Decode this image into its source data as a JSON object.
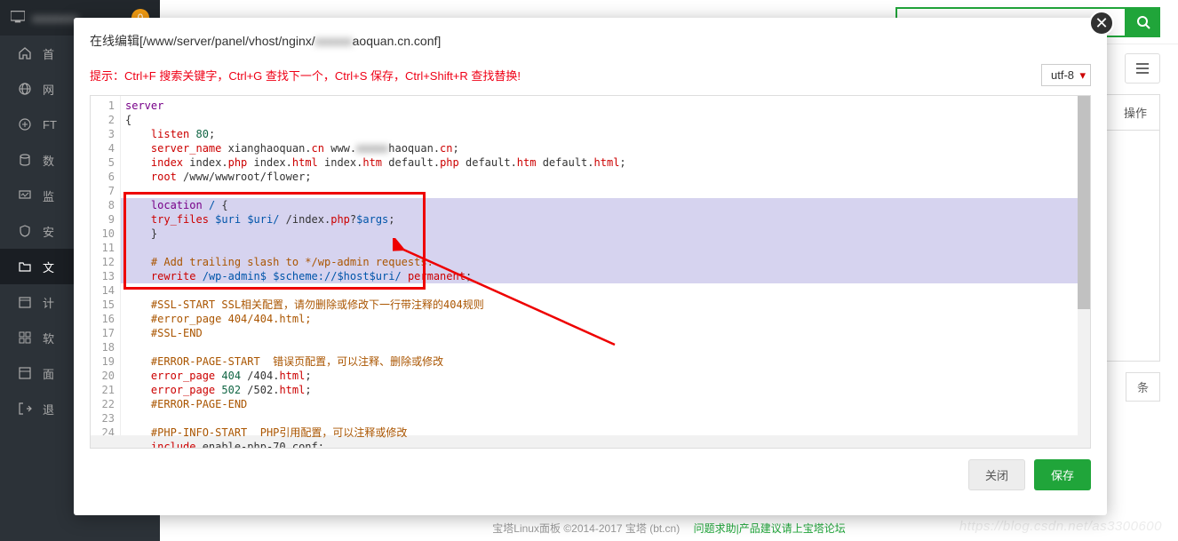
{
  "sidebar": {
    "badge": "0",
    "items": [
      {
        "label": "首",
        "icon": "home"
      },
      {
        "label": "网",
        "icon": "globe"
      },
      {
        "label": "FT",
        "icon": "ftp"
      },
      {
        "label": "数",
        "icon": "db"
      },
      {
        "label": "监",
        "icon": "monitor"
      },
      {
        "label": "安",
        "icon": "shield"
      },
      {
        "label": "文",
        "icon": "folder",
        "active": true
      },
      {
        "label": "计",
        "icon": "calendar"
      },
      {
        "label": "软",
        "icon": "soft"
      },
      {
        "label": "面",
        "icon": "panel"
      },
      {
        "label": "退",
        "icon": "logout"
      }
    ]
  },
  "topbar": {
    "search_placeholder": ""
  },
  "table": {
    "head_action": "操作",
    "foot_unit": "条"
  },
  "footer": {
    "copyright": "宝塔Linux面板 ©2014-2017 宝塔 (bt.cn)",
    "link": "问题求助|产品建议请上宝塔论坛"
  },
  "modal": {
    "title_prefix": "在线编辑[/www/server/panel/vhost/nginx/",
    "title_blur": "xxxxxx",
    "title_suffix": "aoquan.cn.conf]",
    "hint": "提示：Ctrl+F 搜索关键字，Ctrl+G 查找下一个，Ctrl+S 保存，Ctrl+Shift+R 查找替换!",
    "encoding": "utf-8",
    "close_btn": "关闭",
    "save_btn": "保存"
  },
  "code": {
    "lines": [
      [
        [
          "kw",
          "server"
        ]
      ],
      [
        [
          "plain",
          "{"
        ]
      ],
      [
        [
          "plain",
          "    "
        ],
        [
          "def",
          "listen"
        ],
        [
          "plain",
          " "
        ],
        [
          "num",
          "80"
        ],
        [
          "plain",
          ";"
        ]
      ],
      [
        [
          "plain",
          "    "
        ],
        [
          "def",
          "server_name"
        ],
        [
          "plain",
          " xianghaoquan."
        ],
        [
          "def",
          "cn"
        ],
        [
          "plain",
          " www."
        ],
        [
          "blur",
          "xxxxx"
        ],
        [
          "plain",
          "haoquan."
        ],
        [
          "def",
          "cn"
        ],
        [
          "plain",
          ";"
        ]
      ],
      [
        [
          "plain",
          "    "
        ],
        [
          "def",
          "index"
        ],
        [
          "plain",
          " index."
        ],
        [
          "def",
          "php"
        ],
        [
          "plain",
          " index."
        ],
        [
          "def",
          "html"
        ],
        [
          "plain",
          " index."
        ],
        [
          "def",
          "htm"
        ],
        [
          "plain",
          " default."
        ],
        [
          "def",
          "php"
        ],
        [
          "plain",
          " default."
        ],
        [
          "def",
          "htm"
        ],
        [
          "plain",
          " default."
        ],
        [
          "def",
          "html"
        ],
        [
          "plain",
          ";"
        ]
      ],
      [
        [
          "plain",
          "    "
        ],
        [
          "def",
          "root"
        ],
        [
          "plain",
          " /www/wwwroot/flower;"
        ]
      ],
      [
        [
          "plain",
          "    "
        ]
      ],
      [
        [
          "plain",
          "    "
        ],
        [
          "kw",
          "location"
        ],
        [
          "plain",
          " "
        ],
        [
          "var",
          "/"
        ],
        [
          "plain",
          " {"
        ]
      ],
      [
        [
          "plain",
          "    "
        ],
        [
          "def",
          "try_files"
        ],
        [
          "plain",
          " "
        ],
        [
          "var",
          "$uri"
        ],
        [
          "plain",
          " "
        ],
        [
          "var",
          "$uri/"
        ],
        [
          "plain",
          " /index."
        ],
        [
          "def",
          "php"
        ],
        [
          "plain",
          "?"
        ],
        [
          "var",
          "$args"
        ],
        [
          "plain",
          ";"
        ]
      ],
      [
        [
          "plain",
          "    }"
        ]
      ],
      [
        [
          "plain",
          "    "
        ]
      ],
      [
        [
          "plain",
          "    "
        ],
        [
          "comment",
          "# Add trailing slash to */wp-admin requests."
        ]
      ],
      [
        [
          "plain",
          "    "
        ],
        [
          "def",
          "rewrite"
        ],
        [
          "plain",
          " "
        ],
        [
          "var",
          "/wp-admin$"
        ],
        [
          "plain",
          " "
        ],
        [
          "var",
          "$scheme://$host$uri/"
        ],
        [
          "plain",
          " "
        ],
        [
          "def",
          "permanent"
        ],
        [
          "plain",
          ";"
        ]
      ],
      [
        [
          "plain",
          "    "
        ]
      ],
      [
        [
          "plain",
          "    "
        ],
        [
          "comment",
          "#SSL-START SSL相关配置，请勿删除或修改下一行带注释的404规则"
        ]
      ],
      [
        [
          "plain",
          "    "
        ],
        [
          "comment",
          "#error_page 404/404.html;"
        ]
      ],
      [
        [
          "plain",
          "    "
        ],
        [
          "comment",
          "#SSL-END"
        ]
      ],
      [
        [
          "plain",
          "    "
        ]
      ],
      [
        [
          "plain",
          "    "
        ],
        [
          "comment",
          "#ERROR-PAGE-START  错误页配置，可以注释、删除或修改"
        ]
      ],
      [
        [
          "plain",
          "    "
        ],
        [
          "def",
          "error_page"
        ],
        [
          "plain",
          " "
        ],
        [
          "num",
          "404"
        ],
        [
          "plain",
          " /404."
        ],
        [
          "def",
          "html"
        ],
        [
          "plain",
          ";"
        ]
      ],
      [
        [
          "plain",
          "    "
        ],
        [
          "def",
          "error_page"
        ],
        [
          "plain",
          " "
        ],
        [
          "num",
          "502"
        ],
        [
          "plain",
          " /502."
        ],
        [
          "def",
          "html"
        ],
        [
          "plain",
          ";"
        ]
      ],
      [
        [
          "plain",
          "    "
        ],
        [
          "comment",
          "#ERROR-PAGE-END"
        ]
      ],
      [
        [
          "plain",
          "    "
        ]
      ],
      [
        [
          "plain",
          "    "
        ],
        [
          "comment",
          "#PHP-INFO-START  PHP引用配置，可以注释或修改"
        ]
      ],
      [
        [
          "plain",
          "    "
        ],
        [
          "def",
          "include"
        ],
        [
          "plain",
          " enable-php-70.conf;"
        ]
      ]
    ]
  },
  "watermark": "https://blog.csdn.net/as3300600"
}
